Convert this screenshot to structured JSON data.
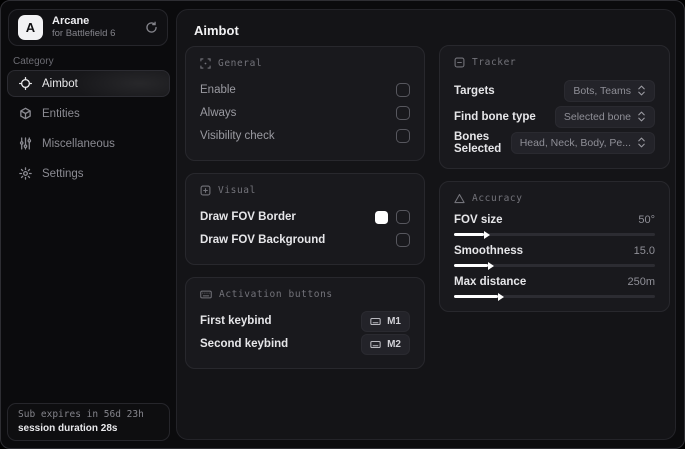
{
  "sidebar": {
    "brand": {
      "initial": "A",
      "title": "Arcane",
      "subtitle": "for Battlefield 6"
    },
    "category_label": "Category",
    "items": [
      {
        "label": "Aimbot",
        "active": true
      },
      {
        "label": "Entities",
        "active": false
      },
      {
        "label": "Miscellaneous",
        "active": false
      },
      {
        "label": "Settings",
        "active": false
      }
    ],
    "footer": {
      "expiry": "Sub expires in 56d 23h",
      "session": "session duration 28s"
    }
  },
  "main": {
    "title": "Aimbot",
    "general": {
      "title": "General",
      "rows": [
        {
          "label": "Enable",
          "checked": false
        },
        {
          "label": "Always",
          "checked": false
        },
        {
          "label": "Visibility check",
          "checked": false
        }
      ]
    },
    "visual": {
      "title": "Visual",
      "rows": [
        {
          "label": "Draw FOV Border",
          "checked": false,
          "swatch": "#ffffff"
        },
        {
          "label": "Draw FOV Background",
          "checked": false
        }
      ]
    },
    "activation": {
      "title": "Activation buttons",
      "rows": [
        {
          "label": "First keybind",
          "key": "M1"
        },
        {
          "label": "Second keybind",
          "key": "M2"
        }
      ]
    },
    "tracker": {
      "title": "Tracker",
      "rows": [
        {
          "label": "Targets",
          "value": "Bots, Teams"
        },
        {
          "label": "Find bone type",
          "value": "Selected bone"
        },
        {
          "label": "Bones Selected",
          "value": "Head, Neck, Body, Pe..."
        }
      ]
    },
    "accuracy": {
      "title": "Accuracy",
      "rows": [
        {
          "label": "FOV size",
          "value": "50°",
          "fill": "15%"
        },
        {
          "label": "Smoothness",
          "value": "15.0",
          "fill": "17%"
        },
        {
          "label": "Max distance",
          "value": "250m",
          "fill": "22%"
        }
      ]
    }
  }
}
